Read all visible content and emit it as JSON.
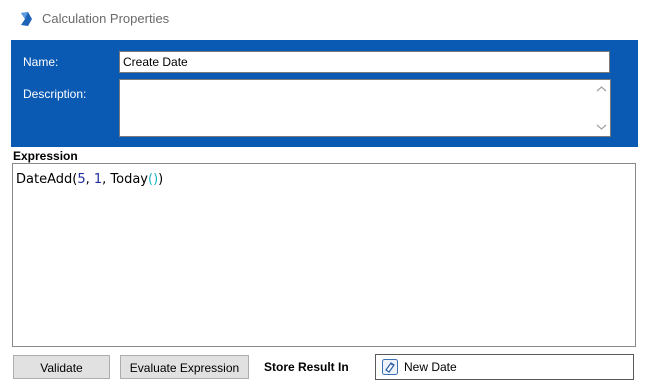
{
  "window": {
    "title": "Calculation Properties",
    "icon": "calculation-app-icon"
  },
  "form": {
    "name_label": "Name:",
    "name_value": "Create Date",
    "description_label": "Description:",
    "description_value": ""
  },
  "expression": {
    "label": "Expression",
    "code_tokens": {
      "func": "DateAdd(",
      "arg1": "5",
      "sep1": ", ",
      "arg2": "1",
      "sep2": ", Today",
      "open_paren": "(",
      "close_paren": ")",
      "end": ")"
    }
  },
  "toolbar": {
    "validate_label": "Validate",
    "evaluate_label": "Evaluate Expression",
    "store_result_label": "Store Result In",
    "store_result_value": "New Date",
    "store_result_icon": "variable-tag-icon"
  },
  "colors": {
    "header_panel": "#0a59b3",
    "number_token": "#1f2f9c",
    "matched_paren": "#18b8c8"
  }
}
